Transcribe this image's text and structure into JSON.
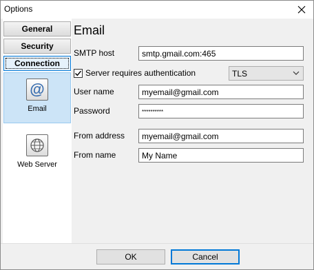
{
  "window": {
    "title": "Options"
  },
  "sidebar": {
    "buttons": [
      {
        "label": "General"
      },
      {
        "label": "Security"
      },
      {
        "label": "Connection"
      }
    ],
    "items": [
      {
        "label": "Email",
        "icon": "at-sign-icon"
      },
      {
        "label": "Web Server",
        "icon": "globe-icon"
      }
    ]
  },
  "email": {
    "heading": "Email",
    "smtp_host_label": "SMTP host",
    "smtp_host_value": "smtp.gmail.com:465",
    "auth_label": "Server requires authentication",
    "auth_checked": true,
    "security_value": "TLS",
    "username_label": "User name",
    "username_value": "myemail@gmail.com",
    "password_label": "Password",
    "password_value": "**********",
    "from_address_label": "From address",
    "from_address_value": "myemail@gmail.com",
    "from_name_label": "From name",
    "from_name_value": "My Name"
  },
  "footer": {
    "ok_label": "OK",
    "cancel_label": "Cancel"
  }
}
